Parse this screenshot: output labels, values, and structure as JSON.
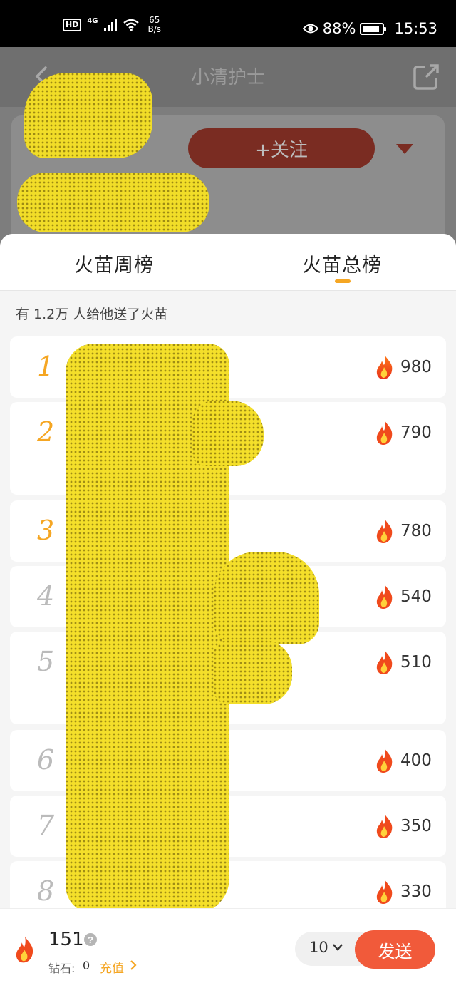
{
  "status_bar": {
    "hd": "HD",
    "network": "4G",
    "speed_value": "65",
    "speed_unit": "B/s",
    "battery": "88%",
    "time": "15:53"
  },
  "background": {
    "title": "小清护士",
    "follow_label": "+关注"
  },
  "tabs": [
    {
      "label": "火苗周榜",
      "active": false
    },
    {
      "label": "火苗总榜",
      "active": true
    }
  ],
  "summary": "有 1.2万 人给他送了火苗",
  "leaderboard": [
    {
      "rank": "1",
      "score": "980"
    },
    {
      "rank": "2",
      "score": "790"
    },
    {
      "rank": "3",
      "score": "780"
    },
    {
      "rank": "4",
      "score": "540"
    },
    {
      "rank": "5",
      "score": "510"
    },
    {
      "rank": "6",
      "score": "400"
    },
    {
      "rank": "7",
      "score": "350"
    },
    {
      "rank": "8",
      "score": "330"
    }
  ],
  "bottom": {
    "balance": "151",
    "diamond_label": "钻石:",
    "diamond_value": "0",
    "recharge_label": "充值",
    "quantity": "10",
    "send_label": "发送"
  },
  "colors": {
    "accent_orange": "#f5a623",
    "send_red": "#f15a3a",
    "redaction_yellow": "#f4df26"
  }
}
